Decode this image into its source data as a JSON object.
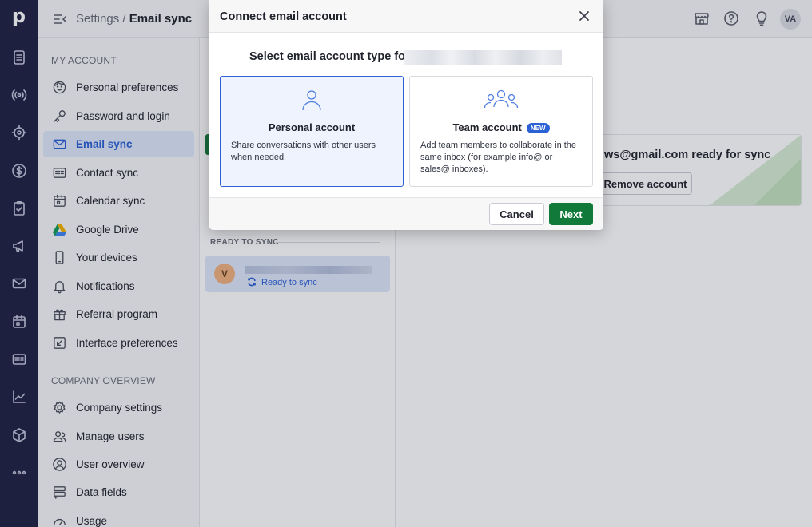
{
  "app": {
    "logo_letter": "p"
  },
  "rail": {
    "items": [
      {
        "icon": "document-icon"
      },
      {
        "icon": "broadcast-icon"
      },
      {
        "icon": "target-icon"
      },
      {
        "icon": "dollar-icon"
      },
      {
        "icon": "clipboard-check-icon"
      },
      {
        "icon": "megaphone-icon"
      },
      {
        "icon": "mail-icon"
      },
      {
        "icon": "calendar-icon"
      },
      {
        "icon": "contact-card-icon"
      },
      {
        "icon": "chart-icon"
      },
      {
        "icon": "box-icon"
      },
      {
        "icon": "more-icon"
      }
    ]
  },
  "header": {
    "breadcrumb_parent": "Settings",
    "breadcrumb_sep": "/",
    "breadcrumb_current": "Email sync",
    "avatar_initials": "VA"
  },
  "sidebar": {
    "my_account_title": "MY ACCOUNT",
    "my_account_items": [
      {
        "label": "Personal preferences",
        "icon": "face-icon"
      },
      {
        "label": "Password and login",
        "icon": "key-icon"
      },
      {
        "label": "Email sync",
        "icon": "mail-icon",
        "active": true
      },
      {
        "label": "Contact sync",
        "icon": "contact-card-icon"
      },
      {
        "label": "Calendar sync",
        "icon": "calendar-icon"
      },
      {
        "label": "Google Drive",
        "icon": "google-drive-icon"
      },
      {
        "label": "Your devices",
        "icon": "phone-icon"
      },
      {
        "label": "Notifications",
        "icon": "bell-icon"
      },
      {
        "label": "Referral program",
        "icon": "gift-icon"
      },
      {
        "label": "Interface preferences",
        "icon": "interface-icon"
      }
    ],
    "company_title": "COMPANY OVERVIEW",
    "company_items": [
      {
        "label": "Company settings",
        "icon": "gear-icon"
      },
      {
        "label": "Manage users",
        "icon": "users-icon"
      },
      {
        "label": "User overview",
        "icon": "user-circle-icon"
      },
      {
        "label": "Data fields",
        "icon": "data-fields-icon"
      },
      {
        "label": "Usage",
        "icon": "gauge-icon"
      }
    ]
  },
  "middle": {
    "ready_title": "READY TO SYNC",
    "account_initial": "V",
    "account_status": "Ready to sync"
  },
  "content": {
    "account_ready_text": "ws@gmail.com ready for sync",
    "remove_label": "Remove account"
  },
  "modal": {
    "title": "Connect email account",
    "prompt": "Select email account type for",
    "personal": {
      "title": "Personal account",
      "description": "Share conversations with other users when needed."
    },
    "team": {
      "title": "Team account",
      "badge": "NEW",
      "description": "Add team members to collaborate in the same inbox (for example info@ or sales@ inboxes)."
    },
    "cancel_label": "Cancel",
    "next_label": "Next"
  },
  "colors": {
    "rail_bg": "#1f2242",
    "accent": "#2c61d6",
    "primary_button": "#117a3b",
    "active_item_bg": "#dfe8fb"
  }
}
